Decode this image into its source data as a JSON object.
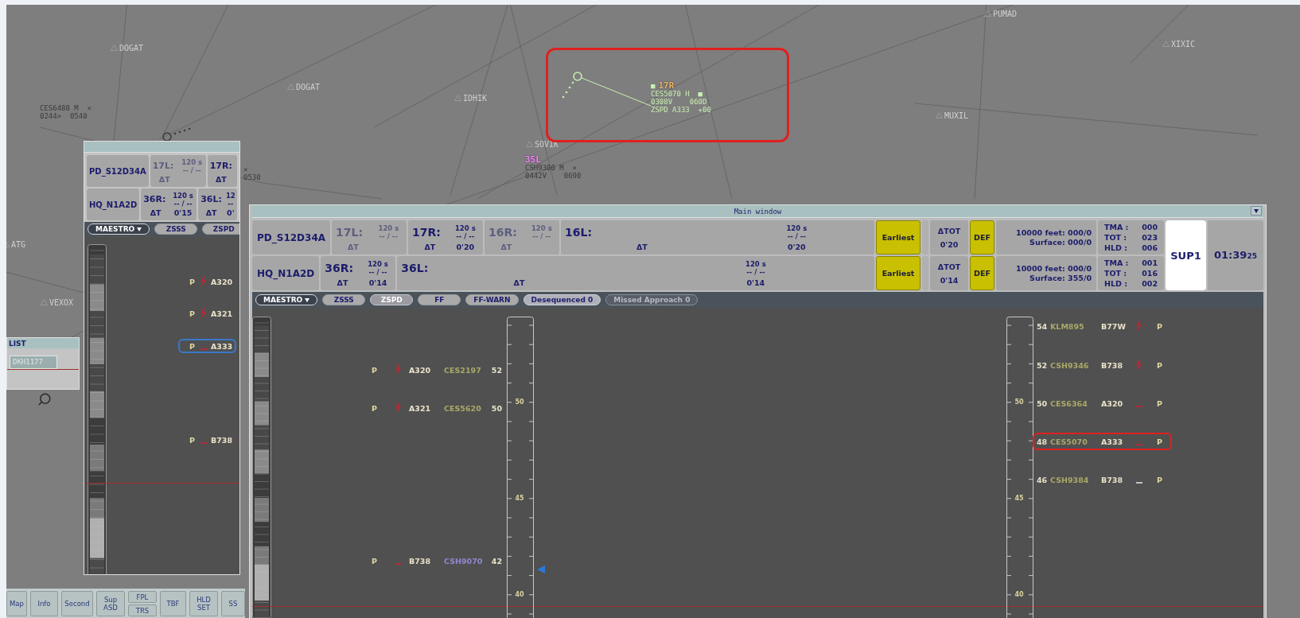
{
  "radar": {
    "waypoints": [
      {
        "name": "DOGAT"
      },
      {
        "name": "DOGAT"
      },
      {
        "name": "IDHIK"
      },
      {
        "name": "SOVIK"
      },
      {
        "name": "PUMAD"
      },
      {
        "name": "XIXIC"
      },
      {
        "name": "MUXIL"
      },
      {
        "name": "ATG"
      },
      {
        "name": "VEXOX"
      }
    ],
    "tracks": [
      {
        "kind": "other",
        "lines": [
          "CES6488 M  ×",
          "0244>  0540"
        ]
      },
      {
        "kind": "other",
        "lines": [
          "×",
          "0530"
        ]
      },
      {
        "kind": "assumed",
        "tag": "■",
        "runway": "17R",
        "color": "#f0b060",
        "lines": [
          "CES5070 H  ■",
          "0308V    060D",
          "ZSPD A333  +00"
        ],
        "highlighted": true
      },
      {
        "kind": "other",
        "runway": "35L",
        "color": "#ff80ff",
        "lines": [
          "CSH9300 M  ×",
          "0442V    0690"
        ]
      }
    ]
  },
  "side_window": {
    "sequences": [
      {
        "name": "PD_S12D34A",
        "runways": [
          {
            "name": "17L:",
            "spacing": "120 s",
            "count": "-- / --",
            "delta_label": "ΔT",
            "active": false
          },
          {
            "name": "17R:",
            "delta_label": "ΔT",
            "active": true
          }
        ]
      },
      {
        "name": "HQ_N1A2D",
        "runways": [
          {
            "name": "36R:",
            "spacing": "120 s",
            "count": "-- / --",
            "delta_label": "ΔT",
            "delta": "0'15",
            "active": true
          },
          {
            "name": "36L:",
            "spacing": "12",
            "count": "--",
            "delta_label": "ΔT",
            "delta": "0'",
            "active": true
          }
        ]
      }
    ],
    "tabs": [
      {
        "kind": "menu",
        "label": "MAESTRO",
        "selected": false
      },
      {
        "kind": "tab",
        "label": "ZSSS",
        "selected": false
      },
      {
        "kind": "tab",
        "label": "ZSPD",
        "selected": false
      }
    ],
    "flights": [
      {
        "status": "P",
        "kind": "bolt",
        "alert": true,
        "type": "A320",
        "selected": false
      },
      {
        "status": "P",
        "kind": "bolt",
        "alert": true,
        "type": "A321",
        "selected": false
      },
      {
        "status": "P",
        "kind": "dash",
        "alert": true,
        "type": "A333",
        "selected": true
      },
      {
        "status": "P",
        "kind": "dash",
        "alert": true,
        "type": "B738",
        "selected": false
      }
    ]
  },
  "list_window": {
    "title": "LIST",
    "entry": "DKH1177"
  },
  "toolbar": [
    {
      "kind": "single",
      "lines": [
        "Map"
      ]
    },
    {
      "kind": "single",
      "lines": [
        "Info"
      ]
    },
    {
      "kind": "single",
      "lines": [
        "Second"
      ]
    },
    {
      "kind": "single",
      "lines": [
        "Sup",
        "ASD"
      ]
    },
    {
      "kind": "pair",
      "labels": [
        "FPL",
        "TRS"
      ]
    },
    {
      "kind": "single",
      "lines": [
        "TBF"
      ]
    },
    {
      "kind": "single",
      "lines": [
        "HLD",
        "SET"
      ]
    },
    {
      "kind": "single",
      "lines": [
        "SS"
      ]
    }
  ],
  "main_window": {
    "title": "Main window",
    "sequences": [
      {
        "name": "PD_S12D34A",
        "runways": [
          {
            "name": "17L:",
            "spacing": "120 s",
            "count": "-- / --",
            "delta_label": "ΔT",
            "active": false
          },
          {
            "name": "17R:",
            "spacing": "120 s",
            "count": "-- / --",
            "delta_label": "ΔT",
            "delta": "0'20",
            "active": true
          },
          {
            "name": "16R:",
            "spacing": "120 s",
            "count": "-- / --",
            "delta_label": "ΔT",
            "active": false
          },
          {
            "name": "16L:",
            "spacing": "120 s",
            "count": "-- / --",
            "delta_label": "ΔT",
            "delta": "0'20",
            "active": true
          }
        ],
        "earliest": "Earliest",
        "dtot_label": "ΔTOT",
        "dtot": "0'20",
        "def": "DEF",
        "feet": "10000 feet: 000/0",
        "surface": "Surface: 000/0",
        "counters": [
          {
            "label": "TMA :",
            "value": "000"
          },
          {
            "label": "TOT :",
            "value": "023"
          },
          {
            "label": "HLD :",
            "value": "006"
          }
        ]
      },
      {
        "name": "HQ_N1A2D",
        "runways": [
          {
            "name": "36R:",
            "spacing": "120 s",
            "count": "-- / --",
            "delta_label": "ΔT",
            "delta": "0'14",
            "active": true
          },
          {
            "name": "36L:",
            "spacing": "120 s",
            "count": "-- / --",
            "delta_label": "ΔT",
            "delta": "0'14",
            "active": true
          }
        ],
        "earliest": "Earliest",
        "dtot_label": "ΔTOT",
        "dtot": "0'14",
        "def": "DEF",
        "feet": "10000 feet: 000/0",
        "surface": "Surface: 355/0",
        "counters": [
          {
            "label": "TMA :",
            "value": "001"
          },
          {
            "label": "TOT :",
            "value": "016"
          },
          {
            "label": "HLD :",
            "value": "002"
          }
        ]
      }
    ],
    "position": "SUP1",
    "clock": "01:39",
    "clock_seconds": "25",
    "tabs": [
      {
        "kind": "menu",
        "label": "MAESTRO",
        "selected": false
      },
      {
        "kind": "tab",
        "label": "ZSSS",
        "selected": false
      },
      {
        "kind": "tab",
        "label": "ZSPD",
        "selected": true
      },
      {
        "kind": "tab",
        "label": "FF",
        "selected": false
      },
      {
        "kind": "tab",
        "label": "FF-WARN",
        "selected": false
      },
      {
        "kind": "counter",
        "label": "Desequenced 0",
        "disabled": false
      },
      {
        "kind": "counter",
        "label": "Missed Approach 0",
        "disabled": true
      }
    ],
    "ladders": [
      {
        "ticks": [
          "50",
          "45",
          "40"
        ],
        "flights": [
          {
            "status": "P",
            "kind": "bolt",
            "alert": true,
            "type": "A320",
            "callsign": "CES2197",
            "color": "#a8a868",
            "slot": "52",
            "highlighted": false
          },
          {
            "status": "P",
            "kind": "bolt",
            "alert": true,
            "type": "A321",
            "callsign": "CES5620",
            "color": "#a8a868",
            "slot": "50",
            "highlighted": false
          },
          {
            "status": "P",
            "kind": "dash",
            "alert": true,
            "type": "B738",
            "callsign": "CSH9070",
            "color": "#9088d0",
            "slot": "42",
            "highlighted": false
          }
        ]
      },
      {
        "ticks": [
          "50",
          "45",
          "40"
        ],
        "flights": [
          {
            "status": "P",
            "kind": "bolt",
            "alert": true,
            "type": "B77W",
            "callsign": "KLM895",
            "color": "#a8a868",
            "slot": "54",
            "highlighted": false
          },
          {
            "status": "P",
            "kind": "bolt",
            "alert": true,
            "type": "B738",
            "callsign": "CSH9346",
            "color": "#a8a868",
            "slot": "52",
            "highlighted": false
          },
          {
            "status": "P",
            "kind": "dash",
            "alert": true,
            "type": "A320",
            "callsign": "CES6364",
            "color": "#a8a868",
            "slot": "50",
            "highlighted": false
          },
          {
            "status": "P",
            "kind": "dash",
            "alert": true,
            "type": "A333",
            "callsign": "CES5070",
            "color": "#a8a868",
            "slot": "48",
            "highlighted": true
          },
          {
            "status": "P",
            "kind": "dash",
            "alert": false,
            "type": "B738",
            "callsign": "CSH9384",
            "color": "#a8a868",
            "slot": "46",
            "highlighted": false
          }
        ]
      }
    ]
  }
}
